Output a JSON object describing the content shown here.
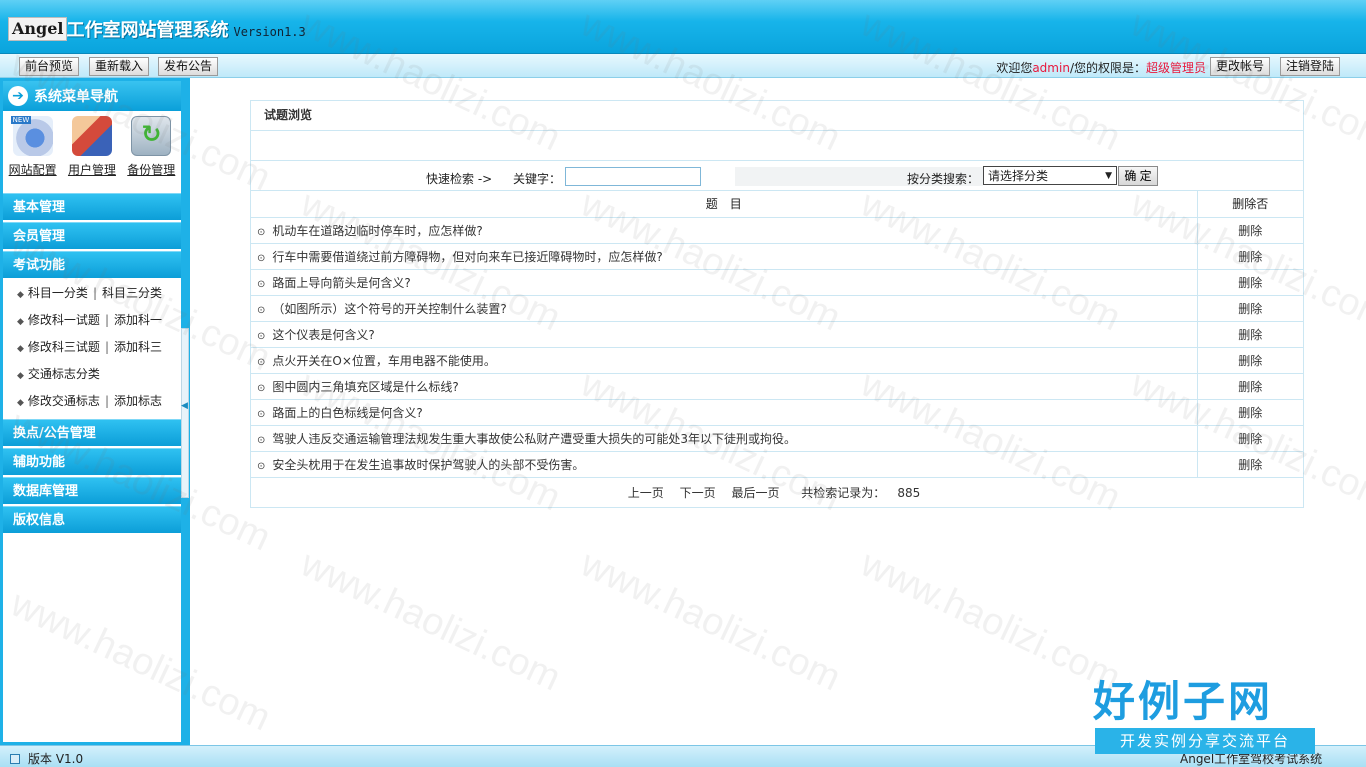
{
  "header": {
    "brand": "Angel",
    "title": "工作室网站管理系统",
    "version": "Version1.3"
  },
  "topbar": {
    "preview_label": "前台预览",
    "reload_label": "重新载入",
    "publish_label": "发布公告",
    "welcome_prefix": "欢迎您",
    "username": "admin",
    "permission_text": "/您的权限是：",
    "role": "超级管理员",
    "account_label": "更改帐号",
    "logout_label": "注销登陆"
  },
  "sidebar": {
    "menu_title": "系统菜单导航",
    "shortcuts": [
      {
        "label": "网站配置",
        "icon": "site-config-icon"
      },
      {
        "label": "用户管理",
        "icon": "user-management-icon"
      },
      {
        "label": "备份管理",
        "icon": "backup-icon"
      }
    ],
    "sections": [
      {
        "label": "基本管理"
      },
      {
        "label": "会员管理"
      },
      {
        "label": "考试功能"
      },
      {
        "label": "换点/公告管理"
      },
      {
        "label": "辅助功能"
      },
      {
        "label": "数据库管理"
      },
      {
        "label": "版权信息"
      }
    ],
    "exam_items": [
      {
        "a": "科目一分类",
        "b": "科目三分类"
      },
      {
        "a": "修改科一试题",
        "b": "添加科一"
      },
      {
        "a": "修改科三试题",
        "b": "添加科三"
      },
      {
        "a": "交通标志分类",
        "b": ""
      },
      {
        "a": "修改交通标志",
        "b": "添加标志"
      }
    ],
    "separator": "|"
  },
  "panel": {
    "title": "试题浏览",
    "quick_search_label": "快速检索 ->",
    "keyword_label": "关键字：",
    "keyword_value": "",
    "category_label": "按分类搜索：",
    "category_selected": "请选择分类",
    "confirm_label": "确 定",
    "col_title": "题　目",
    "col_delete": "删除否",
    "rows": [
      {
        "title": "机动车在道路边临时停车时，应怎样做?",
        "action": "删除"
      },
      {
        "title": "行车中需要借道绕过前方障碍物，但对向来车已接近障碍物时，应怎样做?",
        "action": "删除"
      },
      {
        "title": "路面上导向箭头是何含义?",
        "action": "删除"
      },
      {
        "title": "（如图所示）这个符号的开关控制什么装置?",
        "action": "删除"
      },
      {
        "title": "这个仪表是何含义?",
        "action": "删除"
      },
      {
        "title": "点火开关在O×位置，车用电器不能使用。",
        "action": "删除"
      },
      {
        "title": "图中圆内三角填充区域是什么标线?",
        "action": "删除"
      },
      {
        "title": "路面上的白色标线是何含义?",
        "action": "删除"
      },
      {
        "title": "驾驶人违反交通运输管理法规发生重大事故使公私财产遭受重大损失的可能处3年以下徒刑或拘役。",
        "action": "删除"
      },
      {
        "title": "安全头枕用于在发生追事故时保护驾驶人的头部不受伤害。",
        "action": "删除"
      }
    ],
    "pager": {
      "prev": "上一页",
      "next": "下一页",
      "last": "最后一页",
      "total_label": "共检索记录为：",
      "total": "885"
    }
  },
  "footer": {
    "version": "版本 V1.0",
    "right_text": "Angel工作室驾校考试系统"
  },
  "watermark": {
    "site": "www.haolizi.com",
    "logo_main": "好例子网",
    "logo_sub": "开发实例分享交流平台"
  },
  "colors": {
    "accent": "#0aa4dd",
    "red": "#e8183c",
    "border": "#cce7f3"
  }
}
